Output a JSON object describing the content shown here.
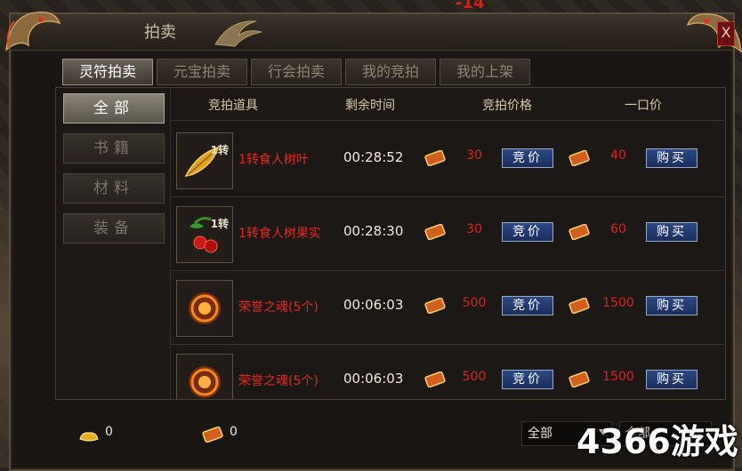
{
  "window": {
    "title": "拍卖",
    "close_label": "X",
    "top_number": "-14"
  },
  "tabs": [
    {
      "label": "灵符拍卖",
      "active": true
    },
    {
      "label": "元宝拍卖"
    },
    {
      "label": "行会拍卖"
    },
    {
      "label": "我的竞拍"
    },
    {
      "label": "我的上架"
    }
  ],
  "sidebar": [
    {
      "label": "全部",
      "active": true
    },
    {
      "label": "书籍"
    },
    {
      "label": "材料"
    },
    {
      "label": "装备"
    }
  ],
  "columns": {
    "item": "竞拍道具",
    "time": "剩余时间",
    "bid": "竞拍价格",
    "buyout": "一口价"
  },
  "rows": [
    {
      "icon": "leaf-icon",
      "badge": "1转",
      "name": "1转食人树叶",
      "time": "00:28:52",
      "bid": "30",
      "buyout": "40",
      "bid_btn": "竞价",
      "buy_btn": "购买"
    },
    {
      "icon": "fruit-icon",
      "badge": "1转",
      "name": "1转食人树果实",
      "time": "00:28:30",
      "bid": "30",
      "buyout": "60",
      "bid_btn": "竞价",
      "buy_btn": "购买"
    },
    {
      "icon": "soul-orb-icon",
      "badge": "",
      "name": "荣誉之魂(5个)",
      "time": "00:06:03",
      "bid": "500",
      "buyout": "1500",
      "bid_btn": "竞价",
      "buy_btn": "购买"
    },
    {
      "icon": "soul-orb-icon",
      "badge": "",
      "name": "荣誉之魂(5个)",
      "time": "00:06:03",
      "bid": "500",
      "buyout": "1500",
      "bid_btn": "竞价",
      "buy_btn": "购买"
    }
  ],
  "footer": {
    "gold": "0",
    "talisman": "0",
    "filter1": "全部",
    "filter2": "全部"
  },
  "watermark": "4366游戏",
  "colors": {
    "price": "#d8241c",
    "item_name": "#e22a20",
    "button": "#1a2e5a"
  }
}
